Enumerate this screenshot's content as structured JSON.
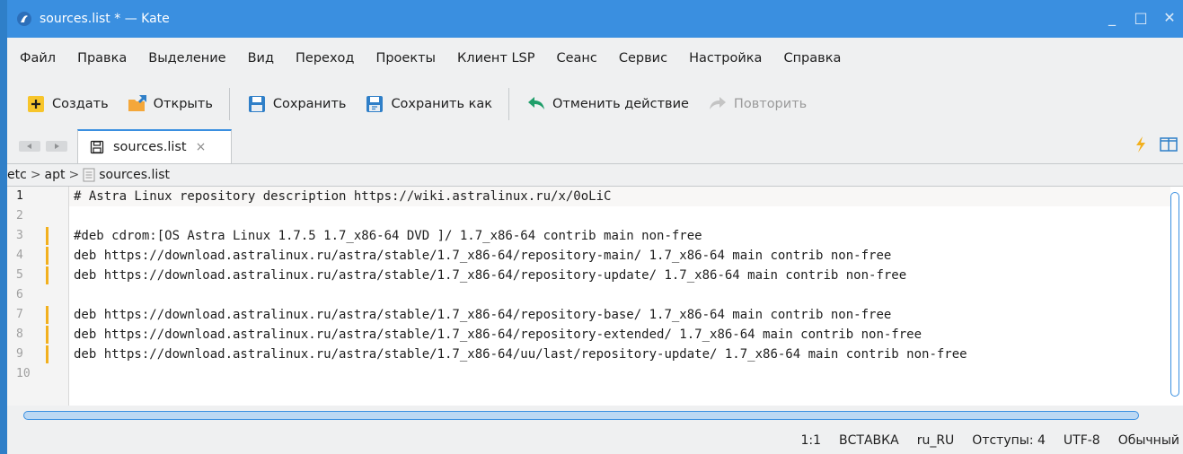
{
  "window": {
    "title": "sources.list * — Kate"
  },
  "menu": [
    "Файл",
    "Правка",
    "Выделение",
    "Вид",
    "Переход",
    "Проекты",
    "Клиент LSP",
    "Сеанс",
    "Сервис",
    "Настройка",
    "Справка"
  ],
  "toolbar": {
    "new_label": "Создать",
    "open_label": "Открыть",
    "save_label": "Сохранить",
    "saveas_label": "Сохранить как",
    "undo_label": "Отменить действие",
    "redo_label": "Повторить"
  },
  "tab": {
    "label": "sources.list",
    "close": "×"
  },
  "breadcrumb": {
    "items": [
      "etc",
      "apt",
      "sources.list"
    ],
    "separator": ">"
  },
  "editor": {
    "line_numbers": [
      "1",
      "2",
      "3",
      "4",
      "5",
      "6",
      "7",
      "8",
      "9",
      "10"
    ],
    "lines": [
      "# Astra Linux repository description https://wiki.astralinux.ru/x/0oLiC",
      "",
      "#deb cdrom:[OS Astra Linux 1.7.5 1.7_x86-64 DVD ]/ 1.7_x86-64 contrib main non-free",
      "deb https://download.astralinux.ru/astra/stable/1.7_x86-64/repository-main/ 1.7_x86-64 main contrib non-free",
      "deb https://download.astralinux.ru/astra/stable/1.7_x86-64/repository-update/ 1.7_x86-64 main contrib non-free",
      "",
      "deb https://download.astralinux.ru/astra/stable/1.7_x86-64/repository-base/ 1.7_x86-64 main contrib non-free",
      "deb https://download.astralinux.ru/astra/stable/1.7_x86-64/repository-extended/ 1.7_x86-64 main contrib non-free",
      "deb https://download.astralinux.ru/astra/stable/1.7_x86-64/uu/last/repository-update/ 1.7_x86-64 main contrib non-free",
      ""
    ],
    "modified_lines": [
      3,
      4,
      5,
      7,
      8,
      9
    ],
    "current_line": 1
  },
  "status": {
    "cursor": "1:1",
    "mode": "ВСТАВКА",
    "language": "ru_RU",
    "indent": "Отступы: 4",
    "encoding": "UTF-8",
    "syntax": "Обычный"
  },
  "colors": {
    "accent": "#3a8fe0",
    "modified_marker": "#f2b01e",
    "chrome": "#eff0f1"
  },
  "icons": {
    "app": "kate-icon",
    "new": "new-document-icon",
    "open": "open-folder-icon",
    "save": "save-icon",
    "saveas": "save-as-icon",
    "undo": "undo-icon",
    "redo": "redo-icon"
  }
}
